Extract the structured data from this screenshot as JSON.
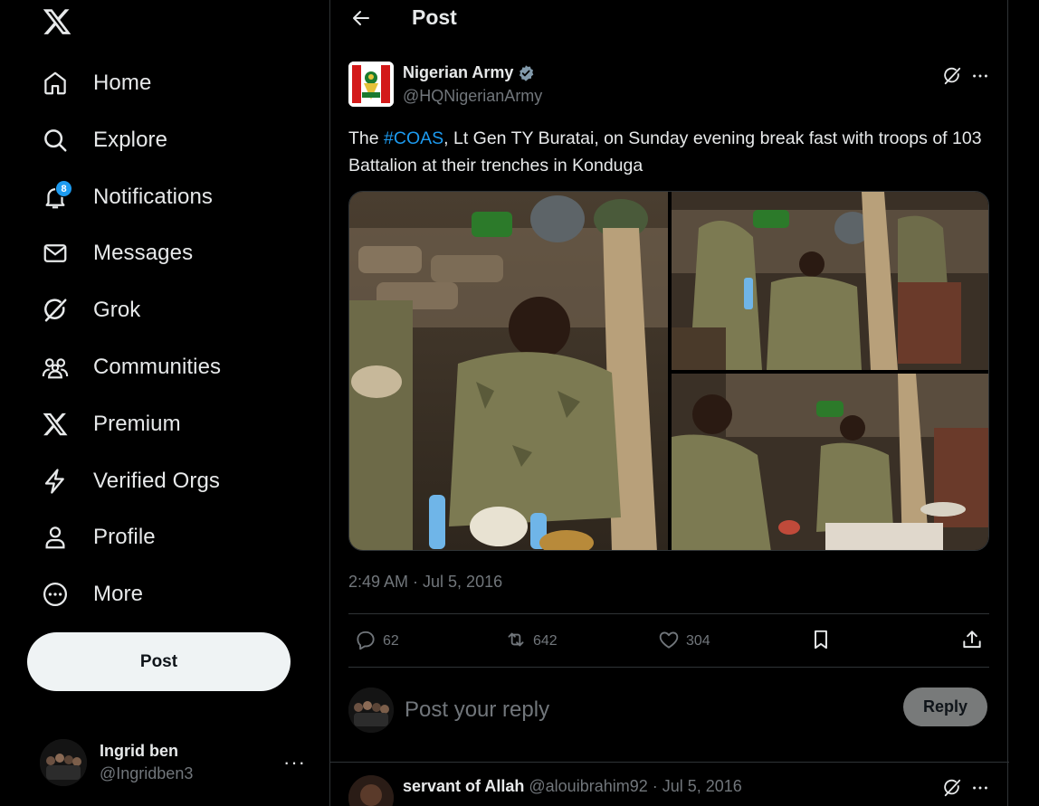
{
  "sidebar": {
    "logo_icon": "x-logo-icon",
    "items": [
      {
        "label": "Home",
        "icon": "home-icon"
      },
      {
        "label": "Explore",
        "icon": "search-icon"
      },
      {
        "label": "Notifications",
        "icon": "bell-icon",
        "badge": "8"
      },
      {
        "label": "Messages",
        "icon": "envelope-icon"
      },
      {
        "label": "Grok",
        "icon": "grok-icon"
      },
      {
        "label": "Communities",
        "icon": "people-icon"
      },
      {
        "label": "Premium",
        "icon": "x-logo-icon"
      },
      {
        "label": "Verified Orgs",
        "icon": "lightning-icon"
      },
      {
        "label": "Profile",
        "icon": "person-icon"
      },
      {
        "label": "More",
        "icon": "more-circle-icon"
      }
    ],
    "post_label": "Post",
    "account": {
      "name": "Ingrid ben",
      "handle": "@Ingridben3",
      "more": "···"
    }
  },
  "header": {
    "title": "Post",
    "back_icon": "arrow-left-icon"
  },
  "tweet": {
    "author_name": "Nigerian Army",
    "author_handle": "@HQNigerianArmy",
    "verified": true,
    "text_before": "The ",
    "hashtag": "#COAS",
    "text_after": ", Lt Gen TY Buratai, on Sunday evening break fast with troops of 103 Battalion at their trenches in Konduga",
    "photo_count": 3,
    "timestamp": "2:49 AM · Jul 5, 2016",
    "stats": {
      "replies": "62",
      "reposts": "642",
      "likes": "304"
    }
  },
  "reply_box": {
    "placeholder": "Post your reply",
    "button_label": "Reply"
  },
  "replies": [
    {
      "name": "servant of Allah",
      "meta": "@alouibrahim92 · Jul 5, 2016"
    }
  ],
  "colors": {
    "accent": "#1d9bf0",
    "background": "#000000",
    "border": "#2f3336",
    "muted": "#71767b",
    "text": "#e7e9ea"
  }
}
